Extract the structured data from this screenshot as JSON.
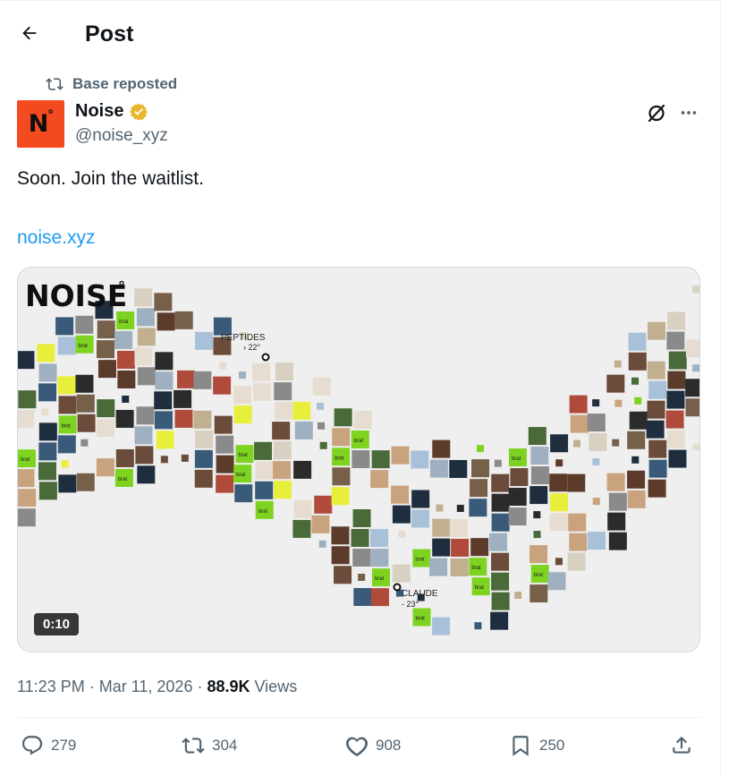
{
  "header": {
    "title": "Post"
  },
  "tweet": {
    "repost_label": "Base reposted",
    "author": {
      "name": "Noise",
      "handle": "@noise_xyz",
      "avatar_text": "N",
      "avatar_mark": "°",
      "verified": true
    },
    "text": "Soon. Join the waitlist.",
    "link": "noise.xyz",
    "media": {
      "brand": "NOISE",
      "brand_mark": "°",
      "label_top_1": "PEPTIDES",
      "label_top_2": "› 22°",
      "label_bottom_1": "CLAUDE",
      "label_bottom_2": "- 23°",
      "duration": "0:10",
      "tile_text": "brat"
    },
    "time": "11:23 PM",
    "date": "Mar 11, 2026",
    "views_count": "88.9K",
    "views_label": "Views",
    "separator": "·"
  },
  "actions": {
    "replies": "279",
    "reposts": "304",
    "likes": "908",
    "bookmarks": "250"
  },
  "colors": {
    "link": "#1d9bf0",
    "secondary": "#536471",
    "avatar_bg": "#f44a1f",
    "verified": "#e8b82b",
    "brat_green": "#7ed321"
  }
}
